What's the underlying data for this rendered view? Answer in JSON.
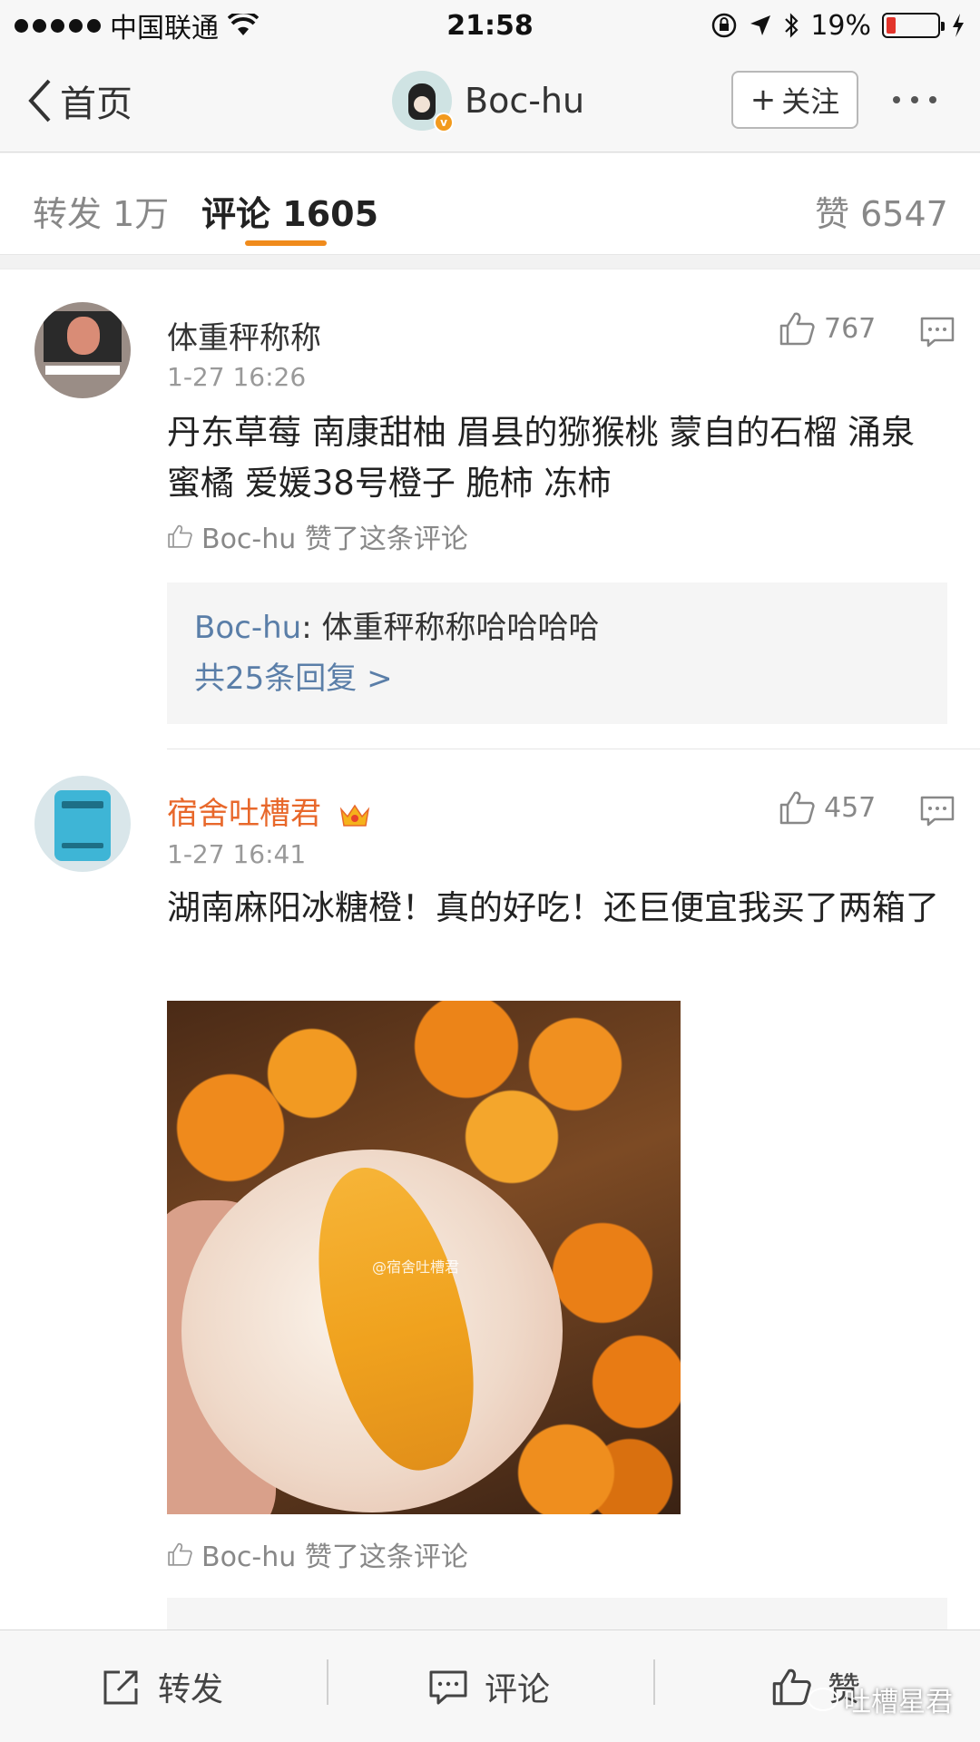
{
  "status_bar": {
    "carrier": "中国联通",
    "time": "21:58",
    "battery_text": "19%",
    "battery_level": 0.19
  },
  "nav": {
    "back_label": "首页",
    "username": "Boc-hu",
    "follow_label": "关注"
  },
  "tabs": {
    "reposts_label": "转发",
    "reposts_count": "1万",
    "comments_label": "评论",
    "comments_count": "1605",
    "likes_label": "赞",
    "likes_count": "6547"
  },
  "comments": [
    {
      "name": "体重秤称称",
      "time": "1-27 16:26",
      "likes": "767",
      "text": "丹东草莓 南康甜柚 眉县的猕猴桃 蒙自的石榴 涌泉蜜橘 爱媛38号橙子 脆柿 冻柿",
      "liked_by": "Boc-hu 赞了这条评论",
      "reply_author": "Boc-hu",
      "reply_text": "体重秤称称哈哈哈哈",
      "reply_more": "共25条回复 >"
    },
    {
      "name": "宿舍吐槽君",
      "time": "1-27 16:41",
      "likes": "457",
      "text": "湖南麻阳冰糖橙！真的好吃！还巨便宜我买了两箱了",
      "image_watermark": "@宿舍吐槽君",
      "liked_by": "Boc-hu 赞了这条评论"
    }
  ],
  "bottom_bar": {
    "repost_label": "转发",
    "comment_label": "评论",
    "like_label": "赞",
    "watermark": "吐槽星君"
  },
  "colors": {
    "accent": "#f08b1c",
    "vip_name": "#e8682b",
    "link_blue": "#5a7ea8"
  }
}
